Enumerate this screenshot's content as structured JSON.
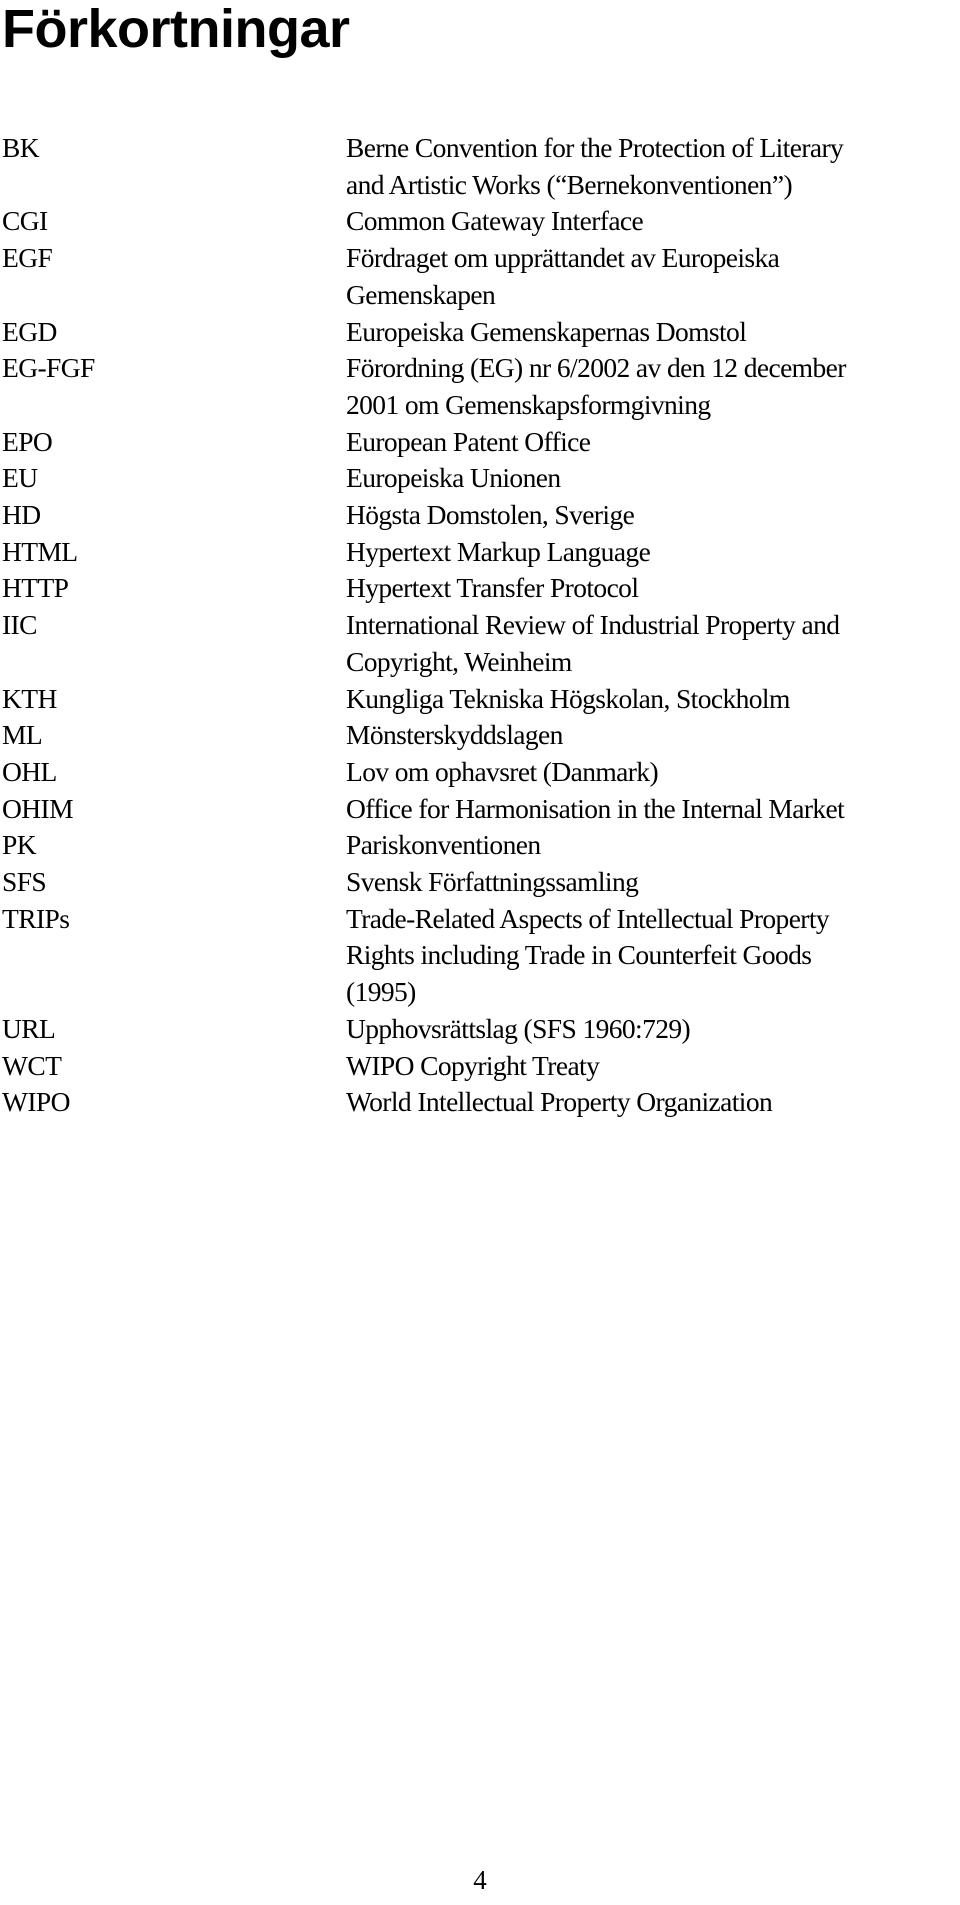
{
  "title": "Förkortningar",
  "abbreviations": [
    {
      "abbr": "BK",
      "lines": [
        "Berne Convention for the Protection of Literary",
        "and Artistic Works (“Bernekonventionen”)"
      ]
    },
    {
      "abbr": "CGI",
      "lines": [
        "Common Gateway Interface"
      ]
    },
    {
      "abbr": "EGF",
      "lines": [
        "Fördraget om upprättandet av Europeiska",
        "Gemenskapen"
      ]
    },
    {
      "abbr": "EGD",
      "lines": [
        "Europeiska Gemenskapernas Domstol"
      ]
    },
    {
      "abbr": "EG-FGF",
      "lines": [
        "Förordning (EG) nr 6/2002 av den 12 december",
        "2001 om Gemenskapsformgivning"
      ]
    },
    {
      "abbr": "EPO",
      "lines": [
        "European Patent Office"
      ]
    },
    {
      "abbr": "EU",
      "lines": [
        "Europeiska Unionen"
      ]
    },
    {
      "abbr": "HD",
      "lines": [
        "Högsta Domstolen, Sverige"
      ]
    },
    {
      "abbr": "HTML",
      "lines": [
        "Hypertext Markup Language"
      ]
    },
    {
      "abbr": "HTTP",
      "lines": [
        "Hypertext Transfer Protocol"
      ]
    },
    {
      "abbr": "IIC",
      "lines": [
        "International Review of Industrial Property and",
        "Copyright, Weinheim"
      ]
    },
    {
      "abbr": "KTH",
      "lines": [
        "Kungliga Tekniska Högskolan, Stockholm"
      ]
    },
    {
      "abbr": "ML",
      "lines": [
        "Mönsterskyddslagen"
      ]
    },
    {
      "abbr": "OHL",
      "lines": [
        "Lov om ophavsret (Danmark)"
      ]
    },
    {
      "abbr": "OHIM",
      "lines": [
        "Office for Harmonisation in the Internal Market"
      ]
    },
    {
      "abbr": "PK",
      "lines": [
        "Pariskonventionen"
      ]
    },
    {
      "abbr": "SFS",
      "lines": [
        "Svensk Författningssamling"
      ]
    },
    {
      "abbr": "TRIPs",
      "lines": [
        "Trade-Related Aspects of Intellectual Property",
        "Rights including Trade in Counterfeit Goods",
        "(1995)"
      ]
    },
    {
      "abbr": "URL",
      "lines": [
        "Upphovsrättslag (SFS 1960:729)"
      ]
    },
    {
      "abbr": "WCT",
      "lines": [
        "WIPO Copyright Treaty"
      ]
    },
    {
      "abbr": "WIPO",
      "lines": [
        "World Intellectual Property Organization"
      ]
    }
  ],
  "page_number": "4"
}
